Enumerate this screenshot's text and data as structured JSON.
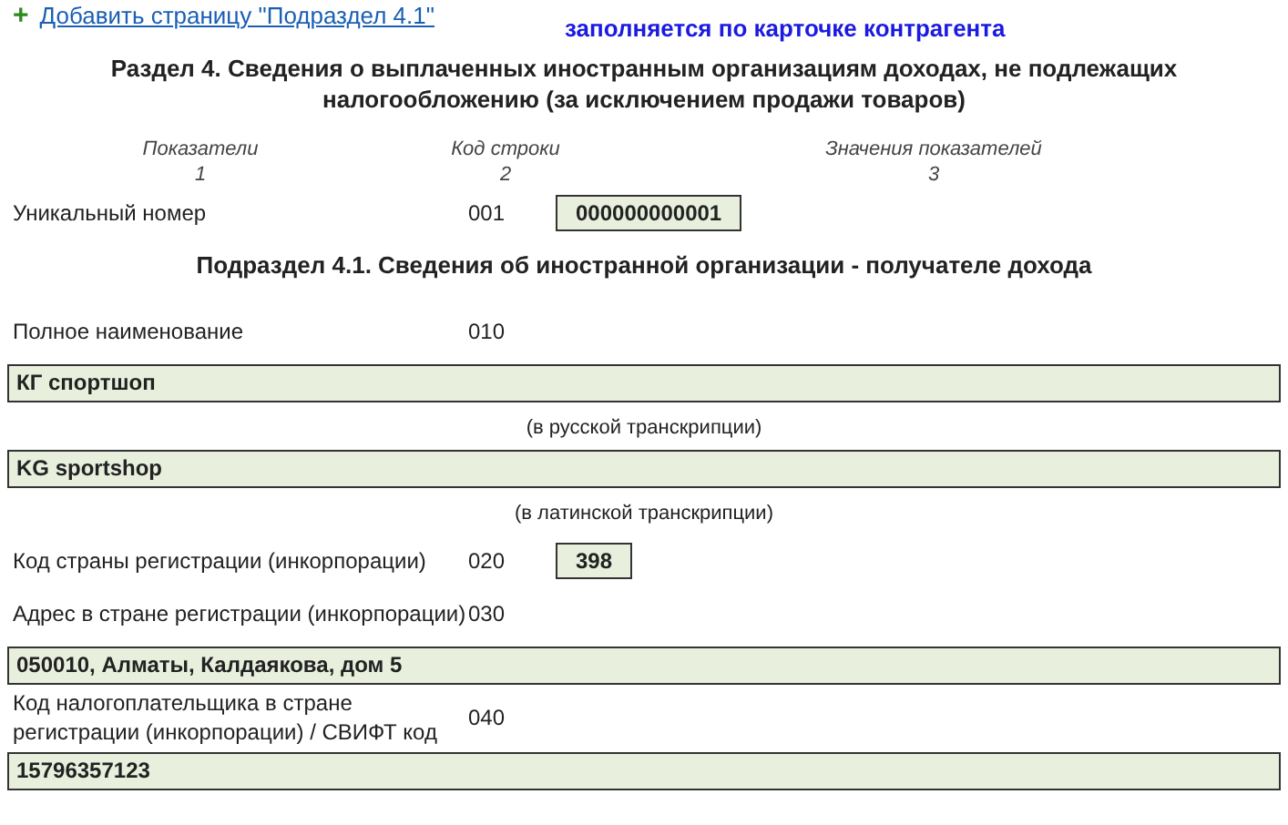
{
  "add_link": {
    "icon": "+",
    "text": "Добавить страницу \"Подраздел 4.1\""
  },
  "note": "заполняется по карточке контрагента",
  "section_title": "Раздел 4. Сведения о выплаченных иностранным организациям доходах, не подлежащих налогообложению (за исключением продажи товаров)",
  "columns": [
    {
      "title": "Показатели",
      "number": "1"
    },
    {
      "title": "Код строки",
      "number": "2"
    },
    {
      "title": "Значения показателей",
      "number": "3"
    }
  ],
  "top_rows": [
    {
      "kind": "inline",
      "label": "Уникальный номер",
      "code": "001",
      "value": "000000000001"
    }
  ],
  "subsection_title": "Подраздел 4.1. Сведения об иностранной организации - получателе дохода",
  "rows": [
    {
      "kind": "block",
      "label": "Полное наименование",
      "code": "010",
      "values": [
        {
          "value": "КГ спортшоп",
          "caption": "(в русской транскрипции)"
        },
        {
          "value": "KG sportshop",
          "caption": "(в латинской транскрипции)"
        }
      ]
    },
    {
      "kind": "inline",
      "label": "Код страны регистрации (инкорпорации)",
      "code": "020",
      "value": "398"
    },
    {
      "kind": "block",
      "label": "Адрес в стране регистрации (инкорпорации)",
      "code": "030",
      "values": [
        {
          "value": "050010, Алматы, Калдаякова, дом 5"
        }
      ]
    },
    {
      "kind": "block",
      "label": "Код налогоплательщика в стране регистрации (инкорпорации) / СВИФТ код",
      "code": "040",
      "values": [
        {
          "value": "15796357123"
        }
      ]
    }
  ]
}
